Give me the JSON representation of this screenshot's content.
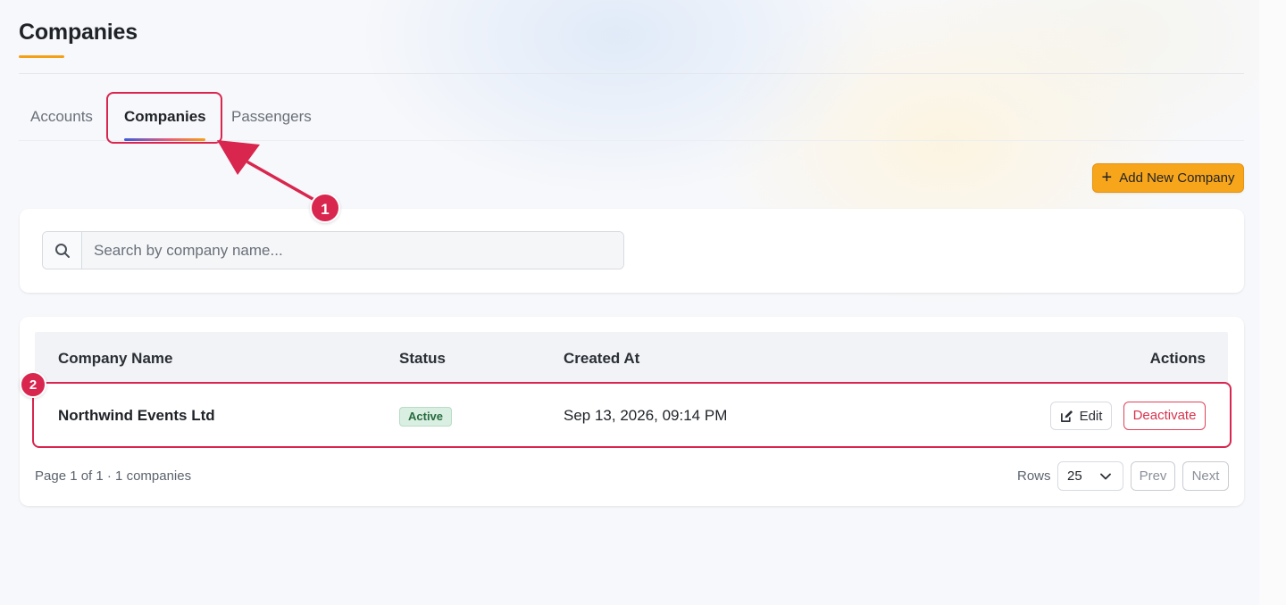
{
  "page": {
    "title": "Companies"
  },
  "tabs": [
    {
      "label": "Accounts",
      "active": false
    },
    {
      "label": "Companies",
      "active": true
    },
    {
      "label": "Passengers",
      "active": false
    }
  ],
  "toolbar": {
    "add_button_label": "Add New Company",
    "add_button_icon": "plus-icon",
    "accent_color": "#f7a51b"
  },
  "search": {
    "placeholder": "Search by company name...",
    "value": "",
    "icon": "search-icon"
  },
  "table": {
    "columns": [
      "Company Name",
      "Status",
      "Created At",
      "Actions"
    ],
    "rows": [
      {
        "company_name": "Northwind Events Ltd",
        "status": "Active",
        "created_at": "Sep 13, 2026, 09:14 PM",
        "actions": {
          "edit_label": "Edit",
          "deactivate_label": "Deactivate"
        }
      }
    ]
  },
  "pagination": {
    "info": "Page 1 of 1 · 1 companies",
    "rows_label": "Rows",
    "rows_value": "25",
    "prev_label": "Prev",
    "next_label": "Next"
  },
  "annotations": [
    {
      "number": "1",
      "target": "Companies tab"
    },
    {
      "number": "2",
      "target": "Northwind Events Ltd row"
    }
  ],
  "colors": {
    "annotation": "#d8264f",
    "status_active_bg": "#d9efe1",
    "status_active_text": "#276b3f",
    "deactivate": "#d8324c"
  }
}
